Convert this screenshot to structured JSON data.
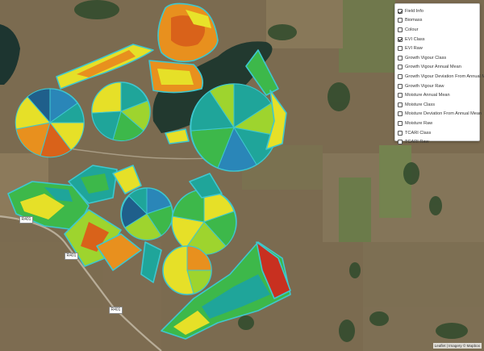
{
  "map": {
    "basemap": "satellite",
    "active_layer": "EVI Class",
    "field_outline_color": "#3ec7cf",
    "colors": {
      "dark_blue": "#1f5f8b",
      "blue": "#2a86b8",
      "teal": "#1fa59a",
      "green": "#3db84a",
      "light_green": "#9ed42e",
      "yellow": "#e8e82a",
      "orange": "#f0a020",
      "dark_orange": "#e06a1a",
      "red": "#c83020",
      "water": "#203a35",
      "soil": "#7a6a4f"
    }
  },
  "layer_control": {
    "items": [
      {
        "label": "Field Info",
        "checked": true
      },
      {
        "label": "Biomass",
        "checked": false
      },
      {
        "label": "Colour",
        "checked": false
      },
      {
        "label": "EVI Class",
        "checked": true
      },
      {
        "label": "EVI Raw",
        "checked": false
      },
      {
        "label": "Growth Vigour Class",
        "checked": false
      },
      {
        "label": "Growth Vigour Annual Mean",
        "checked": false
      },
      {
        "label": "Growth Vigour Deviation From Annual Mean",
        "checked": false
      },
      {
        "label": "Growth Vigour Raw",
        "checked": false
      },
      {
        "label": "Moisture Annual Mean",
        "checked": false
      },
      {
        "label": "Moisture Class",
        "checked": false
      },
      {
        "label": "Moisture Deviation From Annual Mean",
        "checked": false
      },
      {
        "label": "Moisture Raw",
        "checked": false
      },
      {
        "label": "TCARI Class",
        "checked": false
      },
      {
        "label": "TCARI Raw",
        "checked": false
      }
    ]
  },
  "road_labels": [
    "R401",
    "R401",
    "R401"
  ],
  "attribution": "Leaflet | Imagery © Mapbox"
}
